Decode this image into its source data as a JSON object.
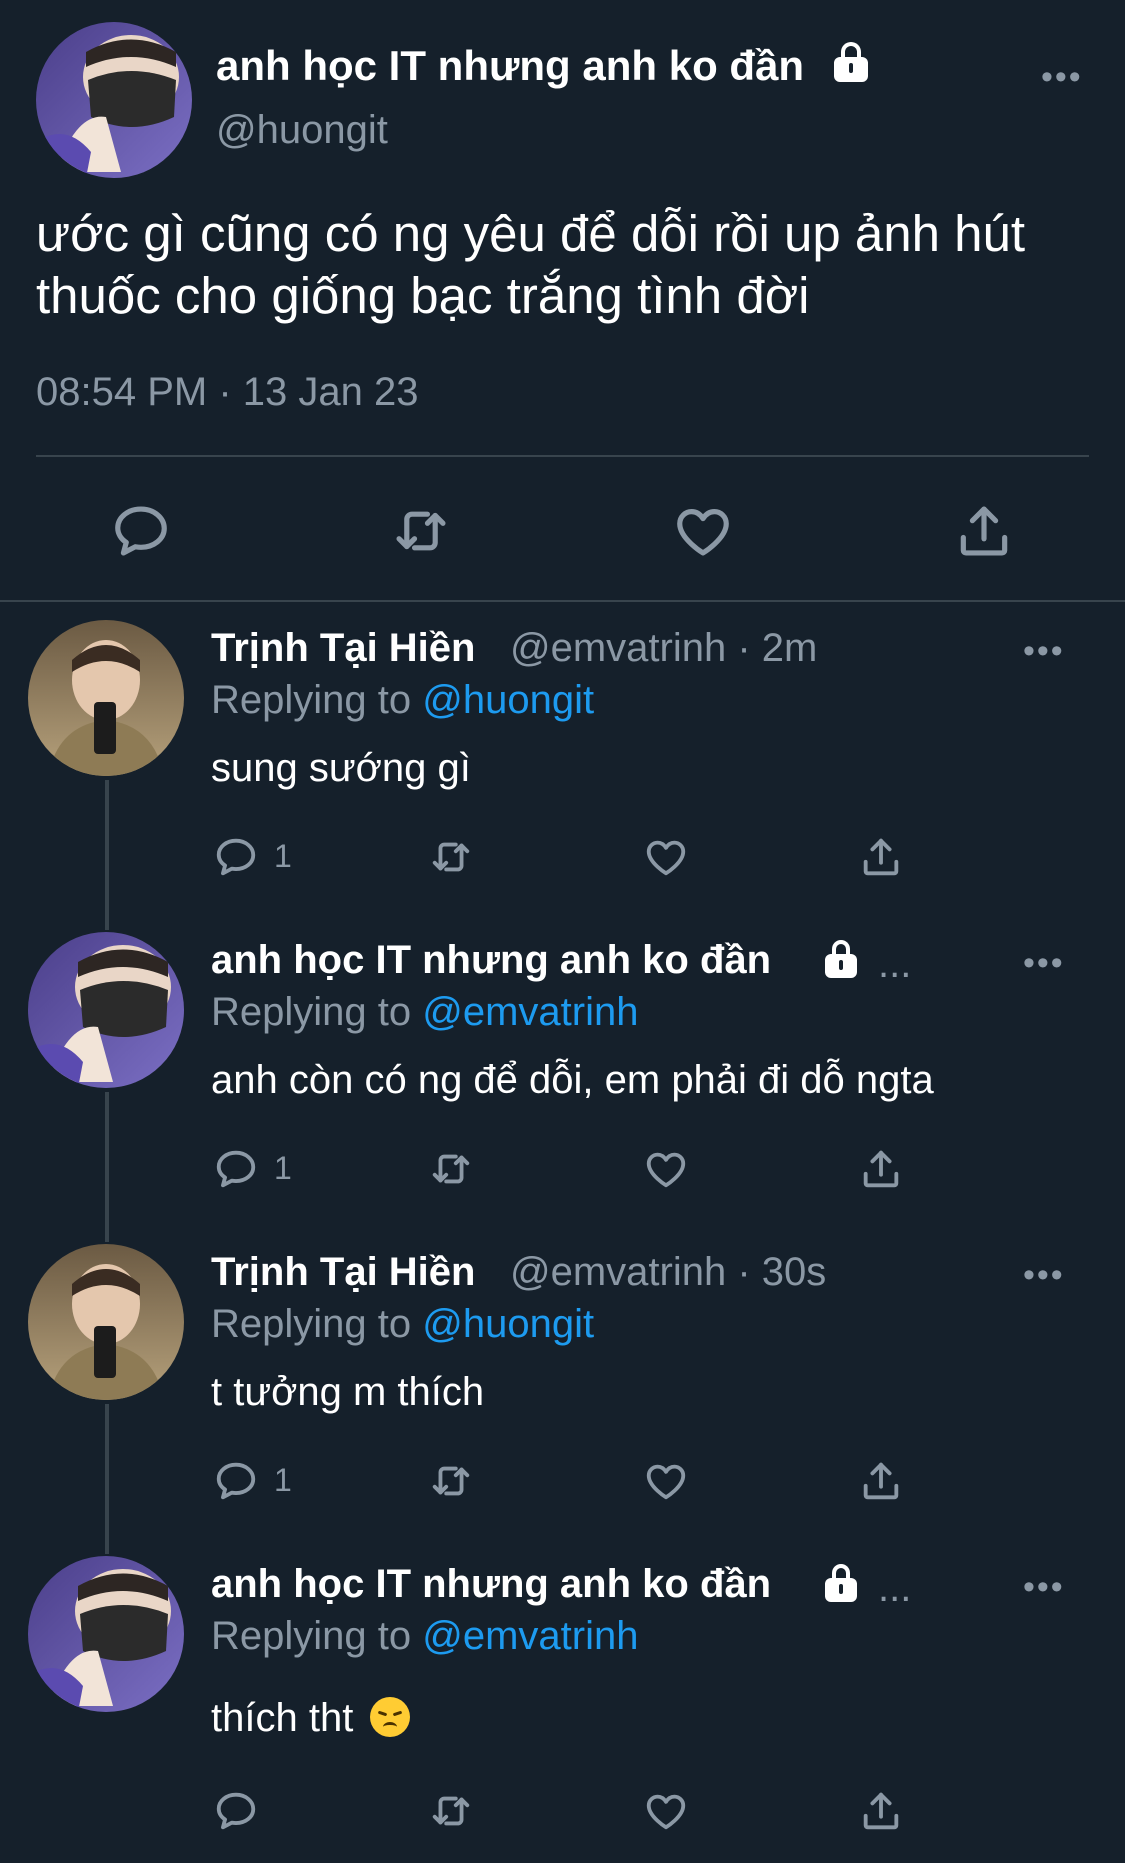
{
  "main_tweet": {
    "display_name": "anh học IT nhưng anh ko đần",
    "handle": "@huongit",
    "text": "ước gì cũng có ng yêu để dỗi rồi up ảnh hút thuốc cho giống bạc trắng tình đời",
    "timestamp": "08:54 PM · 13 Jan 23",
    "more_label": "•••"
  },
  "replies": [
    {
      "display_name": "Trịnh Tại Hiền",
      "meta": "@emvatrinh · 2m",
      "replying_label": "Replying to",
      "replying_to": "@huongit",
      "text": "sung sướng gì",
      "reply_count": "1",
      "more_label": "•••"
    },
    {
      "display_name": "anh học IT nhưng anh ko đần",
      "meta": "...",
      "replying_label": "Replying to",
      "replying_to": "@emvatrinh",
      "text": "anh còn có ng để dỗi, em phải đi dỗ ngta",
      "reply_count": "1",
      "more_label": "•••"
    },
    {
      "display_name": "Trịnh Tại Hiền",
      "meta": "@emvatrinh · 30s",
      "replying_label": "Replying to",
      "replying_to": "@huongit",
      "text": "t tưởng m thích",
      "reply_count": "1",
      "more_label": "•••"
    },
    {
      "display_name": "anh học IT nhưng anh ko đần",
      "meta": "...",
      "replying_label": "Replying to",
      "replying_to": "@emvatrinh",
      "text": "thích tht",
      "reply_count": "",
      "more_label": "•••"
    }
  ],
  "icons": {
    "reply": "speech-bubble-icon",
    "retweet": "retweet-arrows-icon",
    "like": "heart-icon",
    "share": "share-upload-icon",
    "lock": "lock-icon",
    "emoji": "disappointed-face-emoji"
  },
  "colors": {
    "background": "#15202b",
    "text": "#ffffff",
    "secondary_text": "#8b98a5",
    "link": "#1d9bf0",
    "divider": "#38444d"
  }
}
